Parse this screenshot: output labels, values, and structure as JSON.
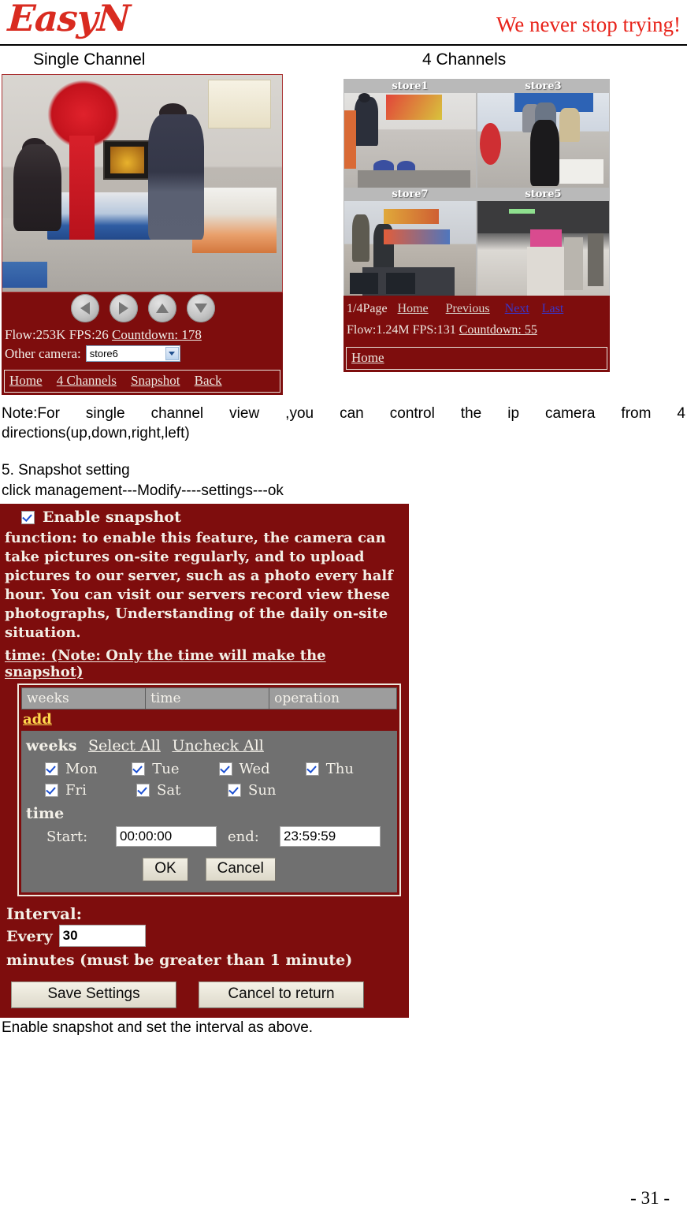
{
  "header": {
    "logo": "EasyN",
    "slogan": "We never stop trying!"
  },
  "sections": {
    "single_title": "Single Channel",
    "four_title": "4 Channels"
  },
  "single_channel": {
    "controls": {
      "left": "left-arrow-icon",
      "right": "right-arrow-icon",
      "up": "up-arrow-icon",
      "down": "down-arrow-icon"
    },
    "stats": "Flow:253K FPS:26",
    "countdown": "Countdown: 178",
    "other_camera_label": "Other camera:",
    "other_camera_value": "store6",
    "nav": [
      "Home",
      "4 Channels",
      "Snapshot",
      "Back"
    ]
  },
  "four_channels": {
    "cells": [
      {
        "label": "store1"
      },
      {
        "label": "store3"
      },
      {
        "label": "store7"
      },
      {
        "label": "store5"
      }
    ],
    "page": "1/4Page",
    "links": [
      "Home",
      "Previous"
    ],
    "links_active": [
      "Next",
      "Last"
    ],
    "stats": "Flow:1.24M FPS:131",
    "countdown": "Countdown: 55",
    "nav": [
      "Home"
    ]
  },
  "note": {
    "line1": "Note:For single channel view ,you can control the ip camera from 4",
    "line2": "directions(up,down,right,left)"
  },
  "step": {
    "heading": "5. Snapshot setting",
    "subheading": "click management---Modify----settings---ok"
  },
  "snapshot": {
    "enable_label": "Enable snapshot",
    "enable_checked": true,
    "description": "function: to enable this feature, the camera can take pictures on-site regularly, and to upload pictures to our server, such as a photo every half hour. You can visit our servers record view these photographs, Understanding of the daily on-site situation.",
    "time_note": "time: (Note: Only the time will make the snapshot)",
    "table_headers": [
      "weeks",
      "time",
      "operation"
    ],
    "add_label": "add",
    "weeks_label": "weeks",
    "select_all": "Select All",
    "uncheck_all": "Uncheck All",
    "days": [
      {
        "label": "Mon",
        "checked": true
      },
      {
        "label": "Tue",
        "checked": true
      },
      {
        "label": "Wed",
        "checked": true
      },
      {
        "label": "Thu",
        "checked": true
      },
      {
        "label": "Fri",
        "checked": true
      },
      {
        "label": "Sat",
        "checked": true
      },
      {
        "label": "Sun",
        "checked": true
      }
    ],
    "time_heading": "time",
    "start_label": "Start:",
    "start_value": "00:00:00",
    "end_label": "end:",
    "end_value": "23:59:59",
    "ok_label": "OK",
    "cancel_label": "Cancel",
    "interval_label": "Interval:",
    "every_label": "Every",
    "interval_value": "30",
    "interval_suffix": "minutes (must be greater than 1 minute)",
    "save_label": "Save Settings",
    "cancel_return_label": "Cancel to return"
  },
  "closing": "Enable snapshot and set the interval as above.",
  "footer": {
    "page": "- 31 -"
  },
  "colors": {
    "panel_bg": "#7e0d0d",
    "brand_red": "#d92b20",
    "link_blue": "#3a36c8",
    "grey_box": "#707070"
  }
}
